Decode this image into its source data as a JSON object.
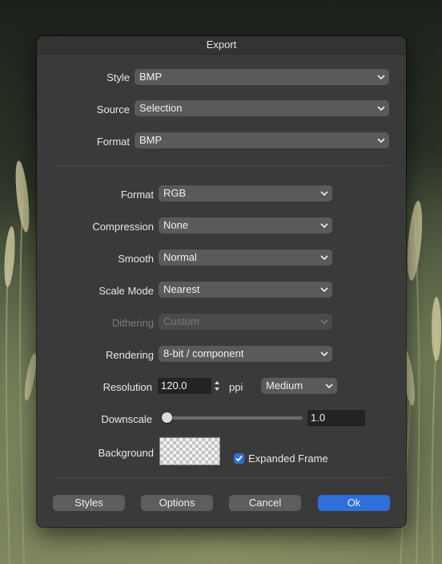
{
  "window": {
    "title": "Export"
  },
  "top": {
    "style": {
      "label": "Style",
      "value": "BMP"
    },
    "source": {
      "label": "Source",
      "value": "Selection"
    },
    "format": {
      "label": "Format",
      "value": "BMP"
    }
  },
  "settings": {
    "format": {
      "label": "Format",
      "value": "RGB"
    },
    "compression": {
      "label": "Compression",
      "value": "None"
    },
    "smooth": {
      "label": "Smooth",
      "value": "Normal"
    },
    "scale_mode": {
      "label": "Scale Mode",
      "value": "Nearest"
    },
    "dithering": {
      "label": "Dithering",
      "value": "Custom",
      "enabled": false
    },
    "rendering": {
      "label": "Rendering",
      "value": "8-bit / component"
    },
    "resolution": {
      "label": "Resolution",
      "value": "120.0",
      "unit": "ppi",
      "quality": "Medium"
    },
    "downscale": {
      "label": "Downscale",
      "value": "1.0",
      "slider_fraction": 0.0
    },
    "background": {
      "label": "Background",
      "swatch": "transparent"
    },
    "expanded_frame": {
      "label": "Expanded Frame",
      "checked": true
    }
  },
  "buttons": {
    "styles": "Styles",
    "options": "Options",
    "cancel": "Cancel",
    "ok": "Ok"
  },
  "colors": {
    "accent": "#2f6fd9",
    "panel": "#3a3a3a",
    "control": "#5a5a5a"
  }
}
